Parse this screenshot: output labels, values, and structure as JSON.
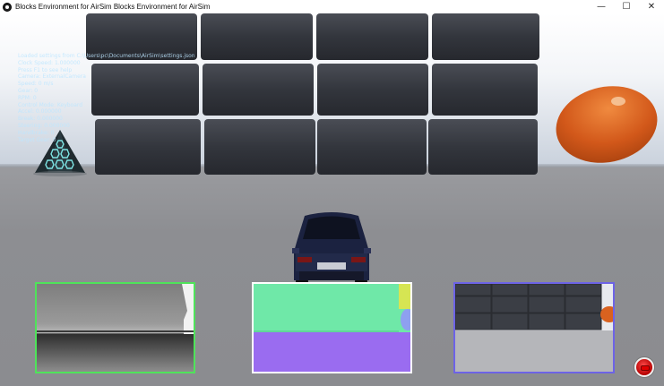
{
  "window": {
    "title": "Blocks Environment for AirSim Blocks Environment for AirSim",
    "controls": {
      "minimize": "—",
      "maximize": "☐",
      "close": "✕"
    }
  },
  "hud": {
    "lines": [
      "Loaded settings from C:\\Users\\pc\\Documents\\AirSim\\settings.json",
      "Clock Speed: 1.000000",
      "Press F1 to see help",
      "Camera: ExternalCamera",
      "Speed: 0 m/s",
      "Gear: 0",
      "RPM: 0",
      "Control Mode: Keyboard",
      "Accel: 0.000000",
      "Break: 0.000000",
      "Steering: 0.000000",
      "Handbrake: 0",
      "Target Gear: 0"
    ]
  },
  "subwindows": {
    "depth": {
      "border_color": "#4fe35a"
    },
    "segmentation": {
      "border_color": "#ffffff",
      "colors": {
        "top": "#6fe8a8",
        "bottom": "#9a6cf0",
        "accent_yellow": "#d6e553",
        "accent_blue": "#8ea0f0"
      }
    },
    "scene": {
      "border_color": "#6d63e6"
    }
  },
  "colors": {
    "egg": "#d9621f",
    "pyramid_glow": "#7de3e3",
    "car_body": "#1b2240"
  },
  "record_button": {
    "state": "off",
    "color": "#d30000"
  }
}
